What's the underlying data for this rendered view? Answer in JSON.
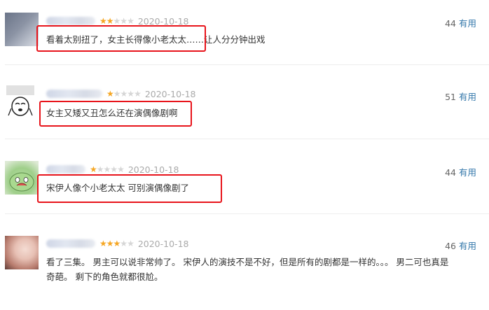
{
  "reviews": [
    {
      "rating": 2,
      "date": "2020-10-18",
      "votes": "44",
      "useful_label": "有用",
      "text": "看着太别扭了，女主长得像小老太太……让人分分钟出戏"
    },
    {
      "rating": 1,
      "date": "2020-10-18",
      "votes": "51",
      "useful_label": "有用",
      "text": "女主又矮又丑怎么还在演偶像剧啊"
    },
    {
      "rating": 1,
      "date": "2020-10-18",
      "votes": "44",
      "useful_label": "有用",
      "text": "宋伊人像个小老太太 可别演偶像剧了"
    },
    {
      "rating": 3,
      "date": "2020-10-18",
      "votes": "46",
      "useful_label": "有用",
      "text_line1": "看了三集。 男主可以说非常帅了。 宋伊人的演技不是不好，但是所有的剧都是一样的。。。 男二可也真是",
      "text_line2": "奇葩。 剩下的角色就都很尬。"
    }
  ],
  "colors": {
    "highlight": "#e8141b",
    "star_on": "#f5a623",
    "star_off": "#d6d6d6",
    "link": "#3377aa"
  }
}
